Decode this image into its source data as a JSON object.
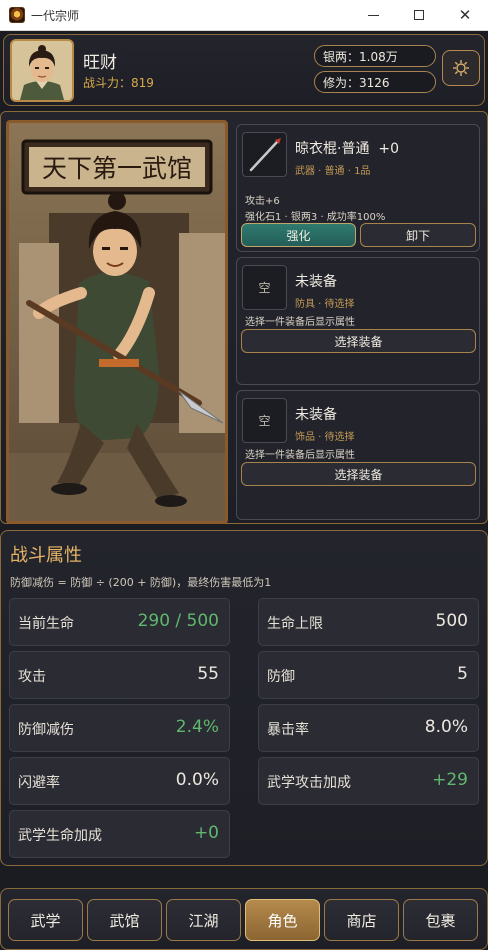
{
  "window": {
    "title": "一代宗师"
  },
  "header": {
    "name": "旺财",
    "power_label": "战斗力：",
    "power_value": "819",
    "silver": "银两：1.08万",
    "cultivation": "修为：3126"
  },
  "portrait": {
    "sign_text": "天下第一武馆"
  },
  "equipment": {
    "weapon": {
      "name": "晾衣棍·普通",
      "level": "+0",
      "sub": "武器 · 普通 · 1品",
      "stat": "攻击+6",
      "cost": "强化石1 · 银两3 · 成功率100%",
      "enhance_label": "强化",
      "unequip_label": "卸下"
    },
    "armor": {
      "icon_text": "空",
      "name": "未装备",
      "sub": "防具 · 待选择",
      "hint": "选择一件装备后显示属性",
      "button": "选择装备"
    },
    "accessory": {
      "icon_text": "空",
      "name": "未装备",
      "sub": "饰品 · 待选择",
      "hint": "选择一件装备后显示属性",
      "button": "选择装备"
    }
  },
  "attributes": {
    "title": "战斗属性",
    "formula": "防御减伤 = 防御 ÷ (200 + 防御)，最终伤害最低为1",
    "items": [
      {
        "label": "当前生命",
        "value": "290 / 500"
      },
      {
        "label": "生命上限",
        "value": "500"
      },
      {
        "label": "攻击",
        "value": "55"
      },
      {
        "label": "防御",
        "value": "5"
      },
      {
        "label": "防御减伤",
        "value": "2.4%"
      },
      {
        "label": "暴击率",
        "value": "8.0%"
      },
      {
        "label": "闪避率",
        "value": "0.0%"
      },
      {
        "label": "武学攻击加成",
        "value": "+29"
      },
      {
        "label": "武学生命加成",
        "value": "+0"
      }
    ]
  },
  "nav": {
    "items": [
      "武学",
      "武馆",
      "江湖",
      "角色",
      "商店",
      "包裹"
    ],
    "active": "角色"
  },
  "colors": {
    "accent_gold": "#d9a94a",
    "positive_green": "#5fb86e",
    "enhance_teal": "#2f7a70"
  }
}
